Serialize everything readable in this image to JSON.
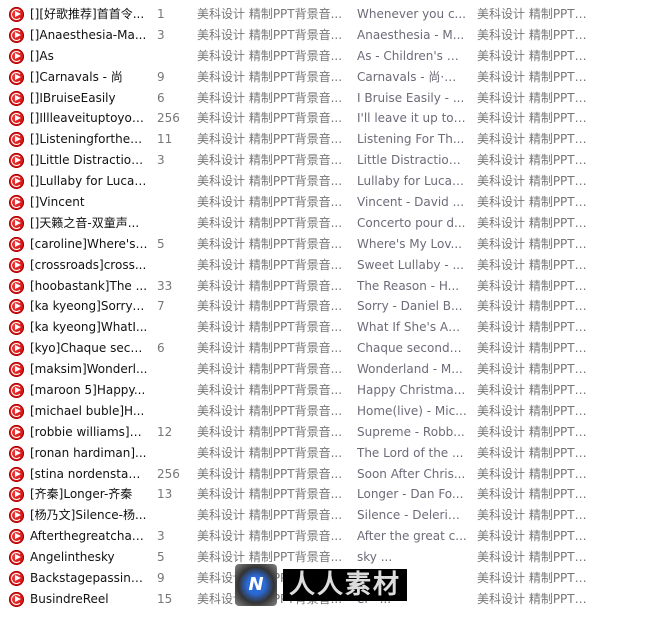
{
  "rows": [
    {
      "name": "[][好歌推荐]首首令...",
      "num": "1",
      "album": "美科设计 精制PPT背景音...",
      "title": "Whenever you c...",
      "artist": "美科设计 精制PPT背..."
    },
    {
      "name": "[]Anaesthesia-Ma...",
      "num": "3",
      "album": "美科设计 精制PPT背景音...",
      "title": "Anaesthesia - M...",
      "artist": "美科设计 精制PPT背..."
    },
    {
      "name": "[]As",
      "num": "",
      "album": "美科设计 精制PPT背景音...",
      "title": "As - Children's D...",
      "artist": "美科设计 精制PPT背..."
    },
    {
      "name": "[]Carnavals - 尚",
      "num": "9",
      "album": "美科设计 精制PPT背景音...",
      "title": "Carnavals - 尚·马...",
      "artist": "美科设计 精制PPT背..."
    },
    {
      "name": "[]IBruiseEasily",
      "num": "6",
      "album": "美科设计 精制PPT背景音...",
      "title": "I Bruise Easily - ...",
      "artist": "美科设计 精制PPT背..."
    },
    {
      "name": "[]Illleaveituptoyou...",
      "num": "256",
      "album": "美科设计 精制PPT背景音...",
      "title": "I'll leave it up to ...",
      "artist": "美科设计 精制PPT背..."
    },
    {
      "name": "[]Listeningforthew...",
      "num": "11",
      "album": "美科设计 精制PPT背景音...",
      "title": "Listening For Th...",
      "artist": "美科设计 精制PPT背..."
    },
    {
      "name": "[]Little Distraction ...",
      "num": "3",
      "album": "美科设计 精制PPT背景音...",
      "title": "Little Distraction ...",
      "artist": "美科设计 精制PPT背..."
    },
    {
      "name": "[]Lullaby for Lucas...",
      "num": "",
      "album": "美科设计 精制PPT背景音...",
      "title": "Lullaby for Lucas...",
      "artist": "美科设计 精制PPT背..."
    },
    {
      "name": "[]Vincent",
      "num": "",
      "album": "美科设计 精制PPT背景音...",
      "title": "Vincent - David ...",
      "artist": "美科设计 精制PPT背..."
    },
    {
      "name": "[]天籁之音-双童声...",
      "num": "",
      "album": "美科设计 精制PPT背景音...",
      "title": "Concerto pour d...",
      "artist": "美科设计 精制PPT背..."
    },
    {
      "name": "[caroline]Where's ...",
      "num": "5",
      "album": "美科设计 精制PPT背景音...",
      "title": "Where's My Lov...",
      "artist": "美科设计 精制PPT背..."
    },
    {
      "name": "[crossroads]cross...",
      "num": "",
      "album": "美科设计 精制PPT背景音...",
      "title": "Sweet Lullaby - ...",
      "artist": "美科设计 精制PPT背..."
    },
    {
      "name": "[hoobastank]The ...",
      "num": "33",
      "album": "美科设计 精制PPT背景音...",
      "title": "The Reason - H...",
      "artist": "美科设计 精制PPT背..."
    },
    {
      "name": "[ka kyeong]Sorry-...",
      "num": "7",
      "album": "美科设计 精制PPT背景音...",
      "title": "Sorry - Daniel B...",
      "artist": "美科设计 精制PPT背..."
    },
    {
      "name": "[ka kyeong]WhatI...",
      "num": "",
      "album": "美科设计 精制PPT背景音...",
      "title": "What If She's An...",
      "artist": "美科设计 精制PPT背..."
    },
    {
      "name": "[kyo]Chaque seco...",
      "num": "6",
      "album": "美科设计 精制PPT背景音...",
      "title": "Chaque seconde...",
      "artist": "美科设计 精制PPT背..."
    },
    {
      "name": "[maksim]Wonderl...",
      "num": "",
      "album": "美科设计 精制PPT背景音...",
      "title": "Wonderland - M...",
      "artist": "美科设计 精制PPT背..."
    },
    {
      "name": "[maroon 5]Happy...",
      "num": "",
      "album": "美科设计 精制PPT背景音...",
      "title": "Happy Christma...",
      "artist": "美科设计 精制PPT背..."
    },
    {
      "name": "[michael buble]H...",
      "num": "",
      "album": "美科设计 精制PPT背景音...",
      "title": "Home(live) - Mic...",
      "artist": "美科设计 精制PPT背..."
    },
    {
      "name": "[robbie williams]S...",
      "num": "12",
      "album": "美科设计 精制PPT背景音...",
      "title": "Supreme - Robb...",
      "artist": "美科设计 精制PPT背..."
    },
    {
      "name": "[ronan hardiman]...",
      "num": "",
      "album": "美科设计 精制PPT背景音...",
      "title": "The Lord of the ...",
      "artist": "美科设计 精制PPT背..."
    },
    {
      "name": "[stina nordenstam...",
      "num": "256",
      "album": "美科设计 精制PPT背景音...",
      "title": "Soon After Chris...",
      "artist": "美科设计 精制PPT背..."
    },
    {
      "name": "[齐秦]Longer-齐秦",
      "num": "13",
      "album": "美科设计 精制PPT背景音...",
      "title": "Longer - Dan Fo...",
      "artist": "美科设计 精制PPT背..."
    },
    {
      "name": "[杨乃文]Silence-杨...",
      "num": "",
      "album": "美科设计 精制PPT背景音...",
      "title": "Silence - Delerium",
      "artist": "美科设计 精制PPT背..."
    },
    {
      "name": "Afterthegreatchan...",
      "num": "3",
      "album": "美科设计 精制PPT背景音...",
      "title": "After the great c...",
      "artist": "美科设计 精制PPT背..."
    },
    {
      "name": "Angelinthesky",
      "num": "5",
      "album": "美科设计 精制PPT背景音...",
      "title": "sky ...",
      "artist": "美科设计 精制PPT背..."
    },
    {
      "name": "Backstagepassins...",
      "num": "9",
      "album": "美科设计 精制PPT背景音...",
      "title": "ass i...",
      "artist": "美科设计 精制PPT背..."
    },
    {
      "name": "BusindreReel",
      "num": "15",
      "album": "美科设计 精制PPT背景音...",
      "title": "el - ...",
      "artist": "美科设计 精制PPT背..."
    }
  ],
  "watermark": {
    "logo": "N",
    "text": "人人素材"
  },
  "colors": {
    "icon": "#d81010",
    "name": "#111111",
    "secondary": "#777777"
  }
}
